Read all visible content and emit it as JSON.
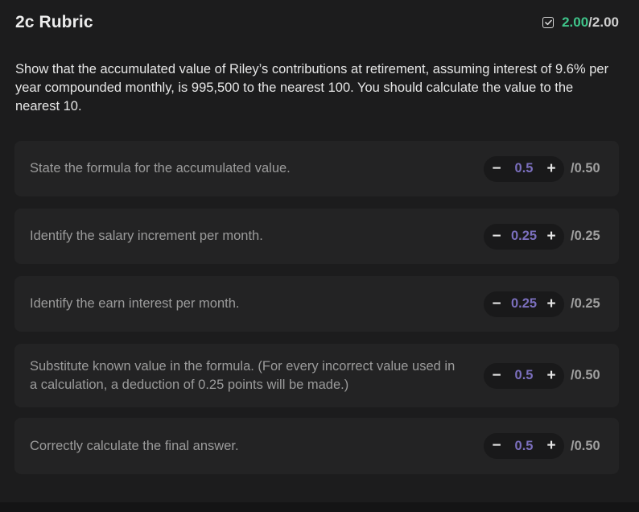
{
  "header": {
    "title": "2c Rubric",
    "score_earned": "2.00",
    "score_separator": "/",
    "score_max": "2.00"
  },
  "question": {
    "text": "Show that the accumulated value of Riley’s contributions at retirement, assuming interest of 9.6% per year compounded monthly, is 995,500 to the nearest 100. You should calculate the value to the nearest 10."
  },
  "criteria": [
    {
      "text": "State the formula for the accumulated value.",
      "value": "0.5",
      "max": "/0.50"
    },
    {
      "text": "Identify the salary increment per month.",
      "value": "0.25",
      "max": "/0.25"
    },
    {
      "text": "Identify the earn interest per month.",
      "value": "0.25",
      "max": "/0.25"
    },
    {
      "text": "Substitute known value in the formula. (For every incorrect value used in a calculation, a deduction of 0.25 points will be made.)",
      "value": "0.5",
      "max": "/0.50"
    },
    {
      "text": "Correctly calculate the final answer.",
      "value": "0.5",
      "max": "/0.50"
    }
  ],
  "controls": {
    "decrement": "−",
    "increment": "+"
  },
  "colors": {
    "background": "#1c1c1d",
    "card": "#232324",
    "earned_green": "#3fc48a",
    "value_purple": "#7b6fbe"
  }
}
